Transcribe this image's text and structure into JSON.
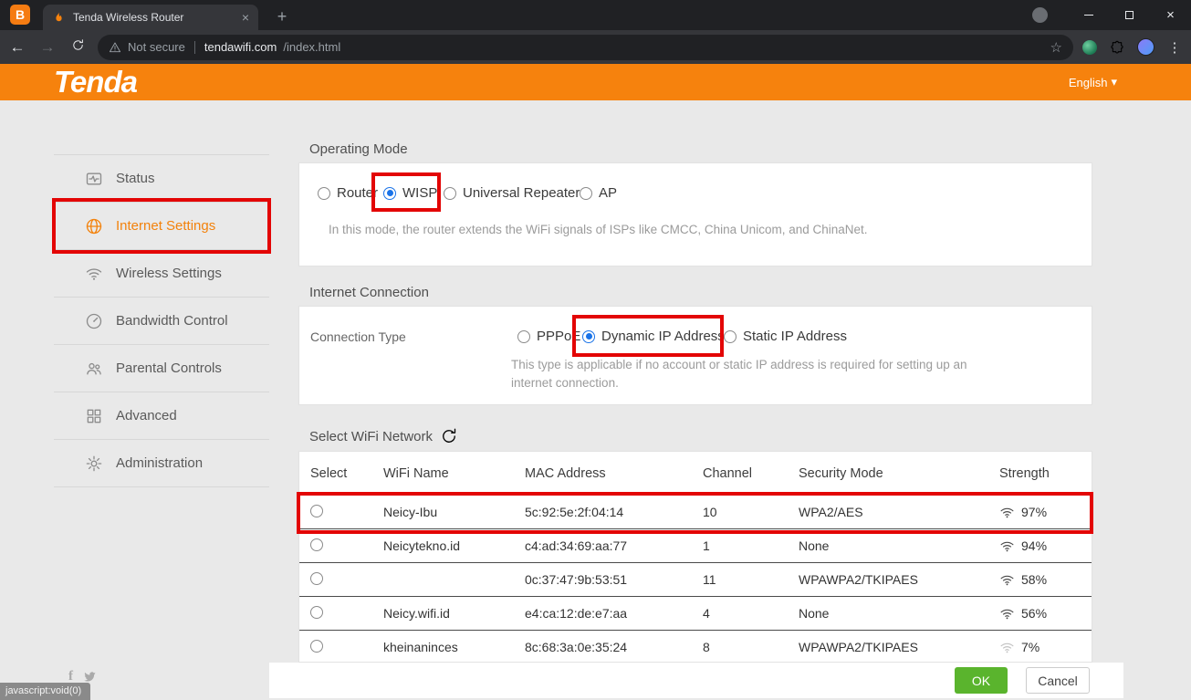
{
  "browser": {
    "pinned_letter": "B",
    "tab": {
      "title": "Tenda Wireless Router"
    },
    "address": {
      "security": "Not secure",
      "host": "tendawifi.com",
      "path": "/index.html"
    }
  },
  "glyphs": {
    "plus": "+",
    "close_tab": "×",
    "close_window": "×",
    "back": "←",
    "forward": "→",
    "star": "☆",
    "kebab": "⋮",
    "caret_down": "▾",
    "facebook_f": "f"
  },
  "brand": {
    "logo": "Tenda",
    "language": "English"
  },
  "sidebar": {
    "items": [
      {
        "label": "Status",
        "icon": "pulse-icon"
      },
      {
        "label": "Internet Settings",
        "icon": "globe-icon",
        "selected": true
      },
      {
        "label": "Wireless Settings",
        "icon": "wifi-icon"
      },
      {
        "label": "Bandwidth Control",
        "icon": "gauge-icon"
      },
      {
        "label": "Parental Controls",
        "icon": "people-icon"
      },
      {
        "label": "Advanced",
        "icon": "grid-icon"
      },
      {
        "label": "Administration",
        "icon": "gear-icon"
      }
    ]
  },
  "operating_mode": {
    "title": "Operating Mode",
    "options": [
      {
        "label": "Router",
        "selected": false
      },
      {
        "label": "WISP",
        "selected": true
      },
      {
        "label": "Universal Repeater",
        "selected": false
      },
      {
        "label": "AP",
        "selected": false
      }
    ],
    "description": "In this mode, the router extends the WiFi signals of ISPs like CMCC, China Unicom, and ChinaNet."
  },
  "internet_connection": {
    "title": "Internet Connection",
    "field_label": "Connection Type",
    "options": [
      {
        "label": "PPPoE",
        "selected": false
      },
      {
        "label": "Dynamic IP Address",
        "selected": true
      },
      {
        "label": "Static IP Address",
        "selected": false
      }
    ],
    "description": "This type is applicable if no account or static IP address is required for setting up an internet connection."
  },
  "wifi_list": {
    "title": "Select WiFi Network",
    "headers": {
      "select": "Select",
      "name": "WiFi Name",
      "mac": "MAC Address",
      "channel": "Channel",
      "security": "Security Mode",
      "strength": "Strength"
    },
    "rows": [
      {
        "name": "Neicy-Ibu",
        "mac": "5c:92:5e:2f:04:14",
        "channel": "10",
        "security": "WPA2/AES",
        "strength": "97%",
        "highlighted": true
      },
      {
        "name": "Neicytekno.id",
        "mac": "c4:ad:34:69:aa:77",
        "channel": "1",
        "security": "None",
        "strength": "94%"
      },
      {
        "name": "",
        "mac": "0c:37:47:9b:53:51",
        "channel": "11",
        "security": "WPAWPA2/TKIPAES",
        "strength": "58%"
      },
      {
        "name": "Neicy.wifi.id",
        "mac": "e4:ca:12:de:e7:aa",
        "channel": "4",
        "security": "None",
        "strength": "56%"
      },
      {
        "name": "kheinaninces",
        "mac": "8c:68:3a:0e:35:24",
        "channel": "8",
        "security": "WPAWPA2/TKIPAES",
        "strength": "7%"
      }
    ]
  },
  "footer": {
    "ok": "OK",
    "cancel": "Cancel"
  },
  "statusbar": {
    "text": "javascript:void(0)"
  },
  "colors": {
    "accent_orange": "#f6820d",
    "ok_green": "#5ab42d",
    "annotation_red": "#e30505"
  }
}
